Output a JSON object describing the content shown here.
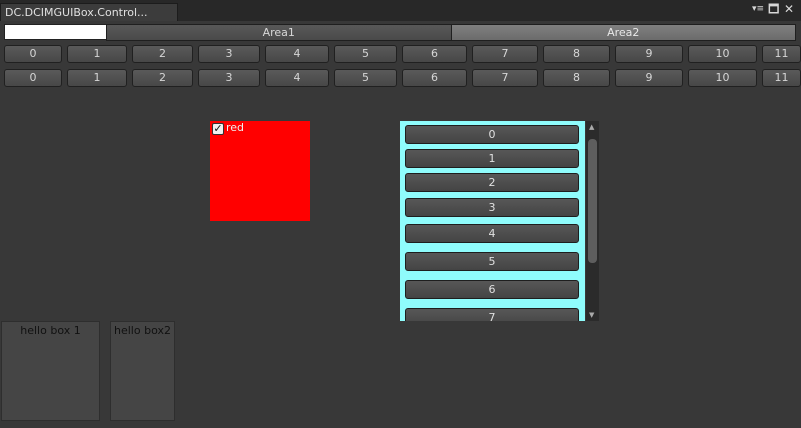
{
  "window": {
    "tab_title": "DC.DCIMGUIBox.Control..."
  },
  "top": {
    "text_field_value": ""
  },
  "toolbar": {
    "items": [
      {
        "label": "Area1"
      },
      {
        "label": "Area2"
      }
    ]
  },
  "button_rows": [
    [
      "0",
      "1",
      "2",
      "3",
      "4",
      "5",
      "6",
      "7",
      "8",
      "9",
      "10",
      "11"
    ],
    [
      "0",
      "1",
      "2",
      "3",
      "4",
      "5",
      "6",
      "7",
      "8",
      "9",
      "10",
      "11"
    ]
  ],
  "colorbox": {
    "toggle_label": "red",
    "toggle_checked": true,
    "color": "#ff0000"
  },
  "scrolllist": {
    "items": [
      "0",
      "1",
      "2",
      "3",
      "4",
      "5",
      "6",
      "7"
    ],
    "frame_color": "#8ffcfc"
  },
  "boxes": [
    {
      "label": "hello box 1"
    },
    {
      "label": "hello box2"
    }
  ]
}
